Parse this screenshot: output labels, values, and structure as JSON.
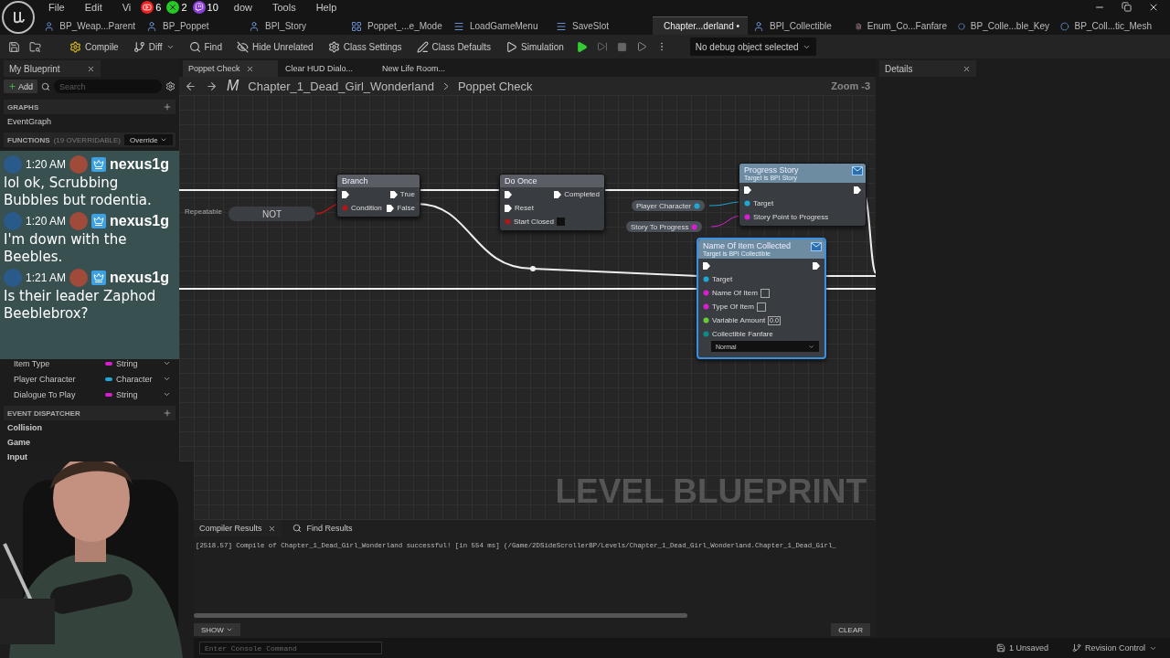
{
  "menu": [
    {
      "label": "File"
    },
    {
      "label": "Edit"
    },
    {
      "label": "Vi"
    },
    {
      "label": "dow"
    },
    {
      "label": "Tools"
    },
    {
      "label": "Help"
    }
  ],
  "stream_badges": [
    {
      "kind": "youtube",
      "count": "6"
    },
    {
      "kind": "xbox",
      "count": "2"
    },
    {
      "kind": "twitch",
      "count": "10"
    }
  ],
  "doc_tabs": [
    {
      "label": "BP_Weap...Parent",
      "kind": "blueprint",
      "selected": false
    },
    {
      "label": "BP_Poppet",
      "kind": "blueprint",
      "selected": false
    },
    {
      "label": "BPI_Story",
      "kind": "interface",
      "selected": false
    },
    {
      "label": "Poppet_...e_Mode",
      "kind": "widget",
      "selected": false
    },
    {
      "label": "LoadGameMenu",
      "kind": "menu",
      "selected": false
    },
    {
      "label": "SaveSlot",
      "kind": "menu",
      "selected": false
    },
    {
      "label": "Chapter...derland •",
      "kind": "level",
      "selected": true
    },
    {
      "label": "BPI_Collectible",
      "kind": "interface",
      "selected": false
    },
    {
      "label": "Enum_Co...Fanfare",
      "kind": "enum",
      "selected": false
    },
    {
      "label": "BP_Colle...ble_Key",
      "kind": "actor",
      "selected": false
    },
    {
      "label": "BP_Coll...tic_Mesh",
      "kind": "actor",
      "selected": false
    }
  ],
  "toolbar": [
    {
      "label": "Compile",
      "kind": "compile"
    },
    {
      "label": "Diff",
      "kind": "diff"
    },
    {
      "label": "Find",
      "kind": "find"
    },
    {
      "label": "Hide Unrelated",
      "kind": "hide"
    },
    {
      "label": "Class Settings",
      "kind": "settings"
    },
    {
      "label": "Class Defaults",
      "kind": "defaults"
    },
    {
      "label": "Simulation",
      "kind": "simulation"
    }
  ],
  "debug_select": {
    "value": "No debug object selected"
  },
  "my_blueprint": {
    "title": "My Blueprint",
    "add": "Add",
    "search_placeholder": "Search",
    "graphs": {
      "title": "GRAPHS",
      "items": [
        "EventGraph"
      ]
    },
    "functions": {
      "title": "FUNCTIONS",
      "count": "(19 OVERRIDABLE)",
      "override": "Override"
    },
    "variables": [
      {
        "name": "Item Type",
        "type": "String",
        "color": "#d61fd0"
      },
      {
        "name": "Player Character",
        "type": "Character",
        "color": "#1fa8d6"
      },
      {
        "name": "Dialogue To Play",
        "type": "String",
        "color": "#d61fd0"
      }
    ],
    "dispatchers": {
      "title": "EVENT DISPATCHER",
      "items": [
        "Collision",
        "Game",
        "Input"
      ]
    }
  },
  "chat": [
    {
      "time": "1:20 AM",
      "user": "nexus1g",
      "text": "lol ok, Scrubbing Bubbles but rodentia."
    },
    {
      "time": "1:20 AM",
      "user": "nexus1g",
      "text": "I'm down with the Beebles."
    },
    {
      "time": "1:21 AM",
      "user": "nexus1g",
      "text": "Is their leader Zaphod Beeblebrox?"
    }
  ],
  "graph_tabs": [
    {
      "label": "Poppet Check",
      "selected": true
    },
    {
      "label": "Clear HUD Dialo...",
      "selected": false
    },
    {
      "label": "New Life Room...",
      "selected": false
    }
  ],
  "breadcrumb": {
    "mark": "M",
    "path": "Chapter_1_Dead_Girl_Wonderland",
    "current": "Poppet Check",
    "zoom": "Zoom -3"
  },
  "graph": {
    "watermark": "LEVEL BLUEPRINT",
    "stray_pin": "Repeatable",
    "nodes": [
      {
        "kind": "operator",
        "title": "NOT"
      },
      {
        "kind": "macro",
        "title": "Branch",
        "rows": [
          {
            "left": {
              "kind": "exec"
            },
            "right": {
              "label": "True",
              "kind": "exec"
            }
          },
          {
            "left": {
              "label": "Condition",
              "kind": "bool"
            },
            "right": {
              "label": "False",
              "kind": "exec"
            }
          }
        ]
      },
      {
        "kind": "macro",
        "title": "Do Once",
        "rows": [
          {
            "left": {
              "kind": "exec"
            },
            "right": {
              "label": "Completed",
              "kind": "exec"
            }
          },
          {
            "left": {
              "label": "Reset",
              "kind": "exec"
            }
          },
          {
            "left": {
              "label": "Start Closed",
              "kind": "bool",
              "checked": false
            }
          }
        ]
      },
      {
        "kind": "variable",
        "title": "Player Character",
        "pin": {
          "kind": "object"
        }
      },
      {
        "kind": "variable",
        "title": "Story To Progress",
        "pin": {
          "kind": "string"
        }
      },
      {
        "kind": "function",
        "title": "Progress Story",
        "subtitle": "Target is BPI Story",
        "selected": false,
        "rows": [
          {
            "left": {
              "kind": "exec"
            },
            "right": {
              "kind": "exec"
            }
          },
          {
            "left": {
              "label": "Target",
              "kind": "object"
            }
          },
          {
            "left": {
              "label": "Story Point to Progress",
              "kind": "string"
            }
          }
        ]
      },
      {
        "kind": "function",
        "title": "Name Of Item Collected",
        "subtitle": "Target is BPI Collectible",
        "selected": true,
        "rows": [
          {
            "left": {
              "kind": "exec"
            },
            "right": {
              "kind": "exec"
            }
          },
          {
            "left": {
              "label": "Target",
              "kind": "object"
            }
          },
          {
            "left": {
              "label": "Name Of Item",
              "kind": "string",
              "input": true
            }
          },
          {
            "left": {
              "label": "Type Of Item",
              "kind": "string",
              "input": true
            }
          },
          {
            "left": {
              "label": "Variable Amount",
              "kind": "float",
              "value": "0.0"
            }
          },
          {
            "left": {
              "label": "Collectible Fanfare",
              "kind": "enum",
              "option": "Normal"
            }
          }
        ]
      }
    ]
  },
  "details": {
    "title": "Details"
  },
  "compiler": {
    "tabs": [
      {
        "label": "Compiler Results",
        "selected": true
      },
      {
        "label": "Find Results",
        "selected": false
      }
    ],
    "log": "[2518.57] Compile of Chapter_1_Dead_Girl_Wonderland successful! [in 554 ms] (/Game/2DSideScrollerBP/Levels/Chapter_1_Dead_Girl_Wonderland.Chapter_1_Dead_Girl_",
    "show": "SHOW",
    "clear": "CLEAR"
  },
  "status": {
    "console_placeholder": "Enter Console Command",
    "unsaved": "1 Unsaved",
    "revision": "Revision Control"
  }
}
